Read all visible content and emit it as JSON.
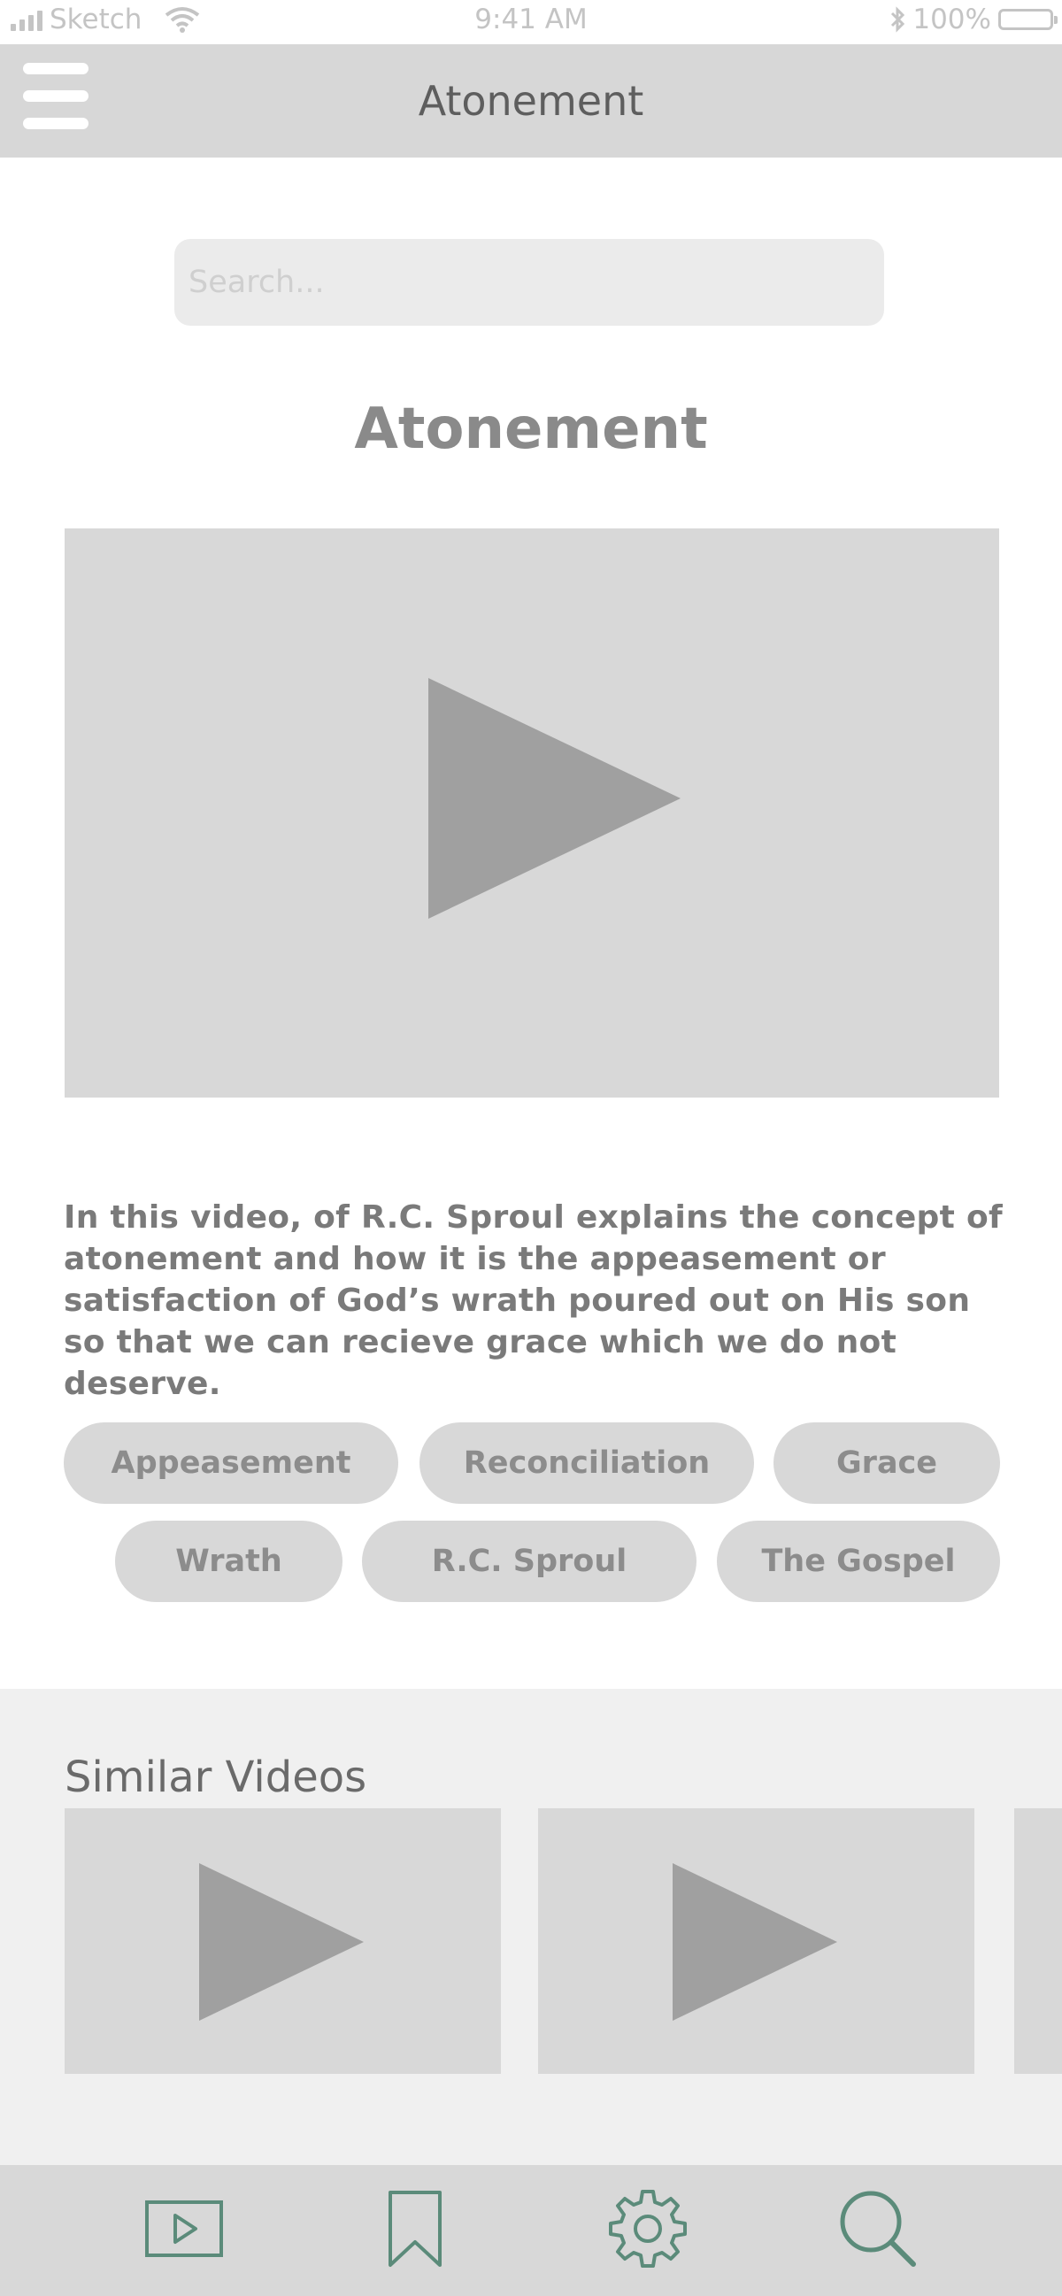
{
  "status_bar": {
    "carrier": "Sketch",
    "time": "9:41 AM",
    "battery": "100%",
    "icons": [
      "signal-icon",
      "wifi-icon",
      "bluetooth-icon",
      "battery-icon"
    ]
  },
  "nav_bar": {
    "title": "Atonement",
    "menu_icon": "hamburger-menu-icon"
  },
  "search": {
    "placeholder": "Search...",
    "value": ""
  },
  "page": {
    "title": "Atonement",
    "description": "In this video, of R.C. Sproul explains the concept of atonement and how it is the appeasement or satisfaction of God’s wrath poured out on His son so that we can recieve grace which we do not deserve."
  },
  "main_video": {
    "icon": "play-icon"
  },
  "tags": [
    "Appeasement",
    "Reconciliation",
    "Grace",
    "Wrath",
    "R.C. Sproul",
    "The Gospel"
  ],
  "similar_videos": {
    "heading": "Similar Videos",
    "count_visible": 3
  },
  "tab_bar": {
    "items": [
      {
        "icon": "video-icon"
      },
      {
        "icon": "bookmark-icon"
      },
      {
        "icon": "settings-gear-icon"
      },
      {
        "icon": "search-icon"
      }
    ],
    "icon_color": "#5b8b7a"
  },
  "colors": {
    "nav_background": "#d7d7d7",
    "placeholder_gray": "#d8d8d8",
    "play_gray": "#a0a0a0",
    "accent_green": "#5b8b7a"
  }
}
